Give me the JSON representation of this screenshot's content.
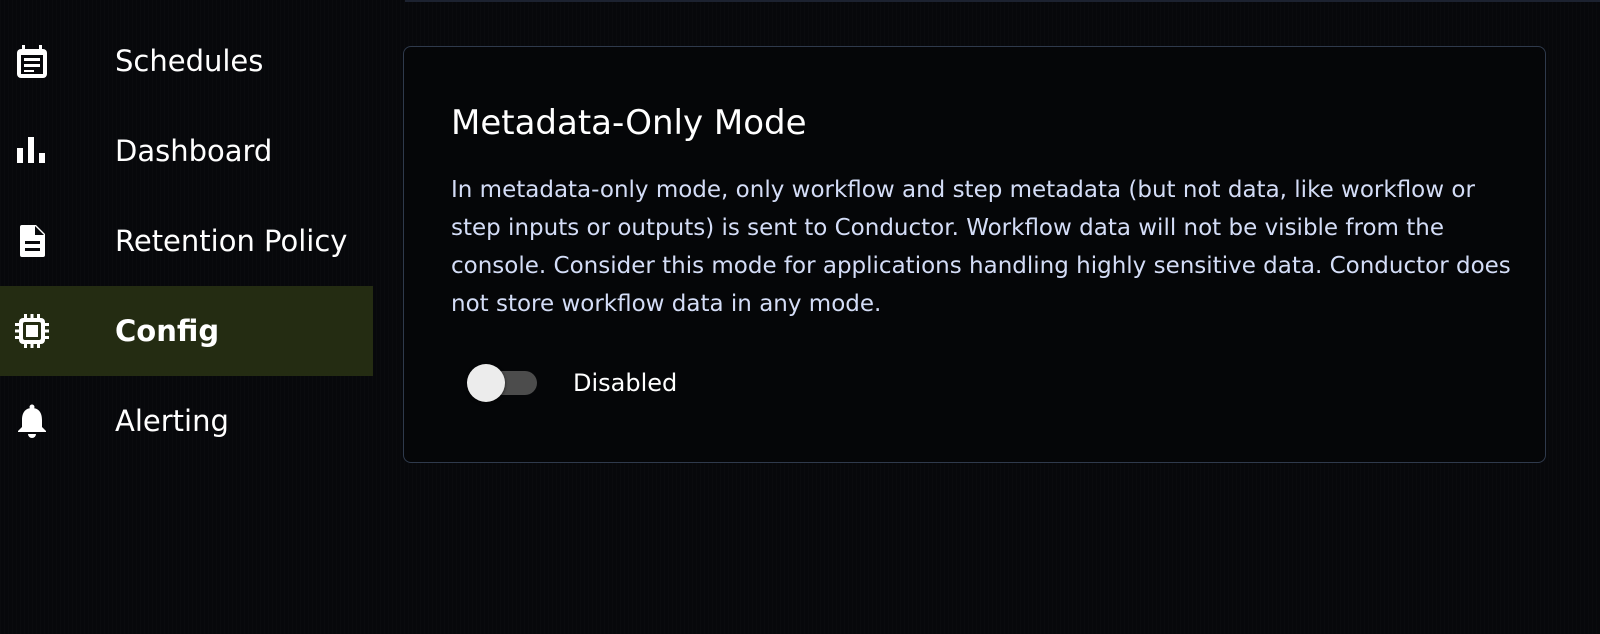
{
  "sidebar": {
    "items": [
      {
        "label": "Schedules",
        "icon": "calendar-icon",
        "active": false
      },
      {
        "label": "Dashboard",
        "icon": "bar-chart-icon",
        "active": false
      },
      {
        "label": "Retention Policy",
        "icon": "document-icon",
        "active": false
      },
      {
        "label": "Config",
        "icon": "chip-icon",
        "active": true
      },
      {
        "label": "Alerting",
        "icon": "bell-icon",
        "active": false
      }
    ]
  },
  "settings": {
    "title": "Metadata-Only Mode",
    "description": "In metadata-only mode, only workflow and step metadata (but not data, like workflow or step inputs or outputs) is sent to Conductor. Workflow data will not be visible from the console. Consider this mode for applications handling highly sensitive data. Conductor does not store workflow data in any mode.",
    "toggle": {
      "label": "Disabled",
      "enabled": false
    }
  },
  "colors": {
    "background": "#07080b",
    "active_nav": "#242c12",
    "card_border": "#2f3a4c",
    "description_text": "#d4ddf7"
  }
}
